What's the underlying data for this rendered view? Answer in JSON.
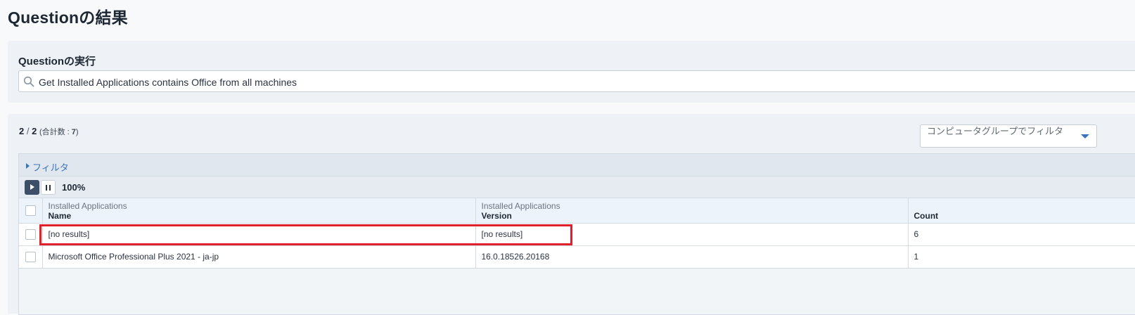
{
  "page": {
    "title": "Questionの結果"
  },
  "ask": {
    "label": "Questionの実行",
    "query": "Get Installed Applications contains Office from all machines",
    "icon": "search-icon"
  },
  "results": {
    "shown": "2",
    "separator": " / ",
    "total_rows": "2",
    "total_label": "(合計数 : ",
    "total_count": "7",
    "total_close": ")",
    "group_filter_placeholder": "コンピュータグループでフィルタ",
    "filter_label": "フィルタ",
    "progress": "100%",
    "progress_value": 1.0,
    "columns": [
      {
        "group": "Installed Applications",
        "name": "Name"
      },
      {
        "group": "Installed Applications",
        "name": "Version"
      },
      {
        "group": "",
        "name": "Count"
      }
    ],
    "rows": [
      {
        "name": "[no results]",
        "version": "[no results]",
        "count": "6",
        "highlighted": true
      },
      {
        "name": "Microsoft Office Professional Plus 2021 - ja-jp",
        "version": "16.0.18526.20168",
        "count": "1",
        "highlighted": false
      }
    ]
  },
  "colors": {
    "accent": "#3a74b8",
    "highlight": "#e0202a",
    "play_button": "#3d4f66"
  }
}
